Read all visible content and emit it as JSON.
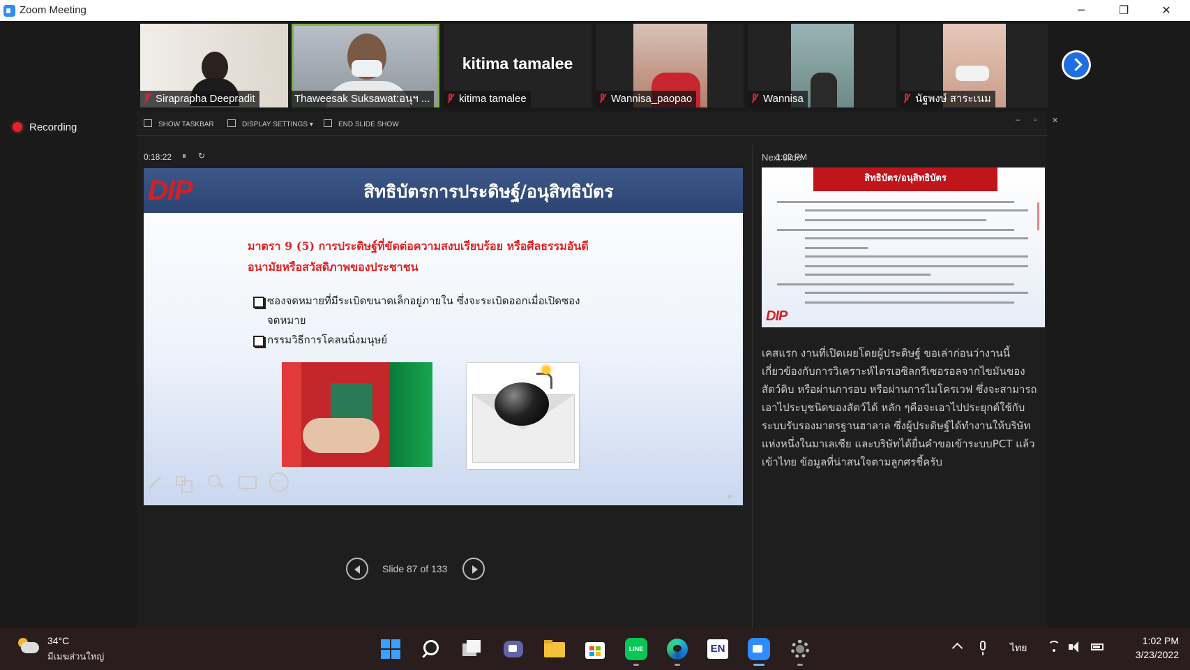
{
  "window": {
    "title": "Zoom Meeting",
    "minimize": "─",
    "maximize": "❐",
    "close": "✕"
  },
  "participants": [
    {
      "name": "Siraprapha Deepradit"
    },
    {
      "name": "Thaweesak Suksawat:อนุฯ ..."
    },
    {
      "name": "kitima tamalee",
      "display_name": "kitima tamalee"
    },
    {
      "name": "Wannisa_paopao"
    },
    {
      "name": "Wannisa"
    },
    {
      "name": "นัฐพงษ์ สาระเนม"
    }
  ],
  "recording": {
    "label": "Recording"
  },
  "presenter_toolbar": {
    "show_taskbar": "SHOW TASKBAR",
    "display_settings": "DISPLAY SETTINGS ▾",
    "end_slide_show": "END SLIDE SHOW",
    "win_minimize": "–",
    "win_restore": "▫",
    "win_close": "✕"
  },
  "timer": {
    "elapsed": "0:18:22",
    "pause": "⏸",
    "reset": "↻",
    "clock": "1:02 PM"
  },
  "current_slide": {
    "logo": "DIP",
    "title": "สิทธิบัตรการประดิษฐ์/อนุสิทธิบัตร",
    "subtitle": "มาตรา 9 (5) การประดิษฐ์ที่ขัดต่อความสงบเรียบร้อย หรือศีลธรรมอันดี อนามัยหรือสวัสดิภาพของประชาชน",
    "bullets": [
      "ซองจดหมายที่มีระเบิดขนาดเล็กอยู่ภายใน ซึ่งจะระเบิดออกเมื่อเปิดซองจดหมาย",
      "กรรมวิธีการโคลนนิ่งมนุษย์"
    ],
    "page_number": "87"
  },
  "navigation": {
    "label": "Slide 87 of 133"
  },
  "next_slide": {
    "label": "Next slide",
    "title": "สิทธิบัตร/อนุสิทธิบัตร",
    "logo": "DIP"
  },
  "notes": "เคสแรก งานที่เปิดเผยโดยผู้ประดิษฐ์ ขอเล่าก่อนว่างานนี้เกี่ยวข้องกับการวิเคราะห์ไตรเอซิลกรีเซอรอลจากไขมันของสัตว์ดิบ หรือผ่านการอบ หรือผ่านการไมโครเวฟ ซึ่งจะสามารถเอาไประบุชนิดของสัตว์ได้ หลัก ๆคือจะเอาไปประยุกต์ใช้กับระบบรับรองมาตรฐานฮาลาล ซึ่งผู้ประดิษฐ์ได้ทำงานให้บริษัทแห่งหนึ่งในมาเลเซีย และบริษัทได้ยื่นคำขอเข้าระบบPCT แล้วเข้าไทย ข้อมูลที่น่าสนใจตามลูกศรชี้ครับ",
  "taskbar": {
    "weather_temp": "34°C",
    "weather_condition": "มีเมฆส่วนใหญ่",
    "language": "ไทย",
    "time": "1:02 PM",
    "date": "3/23/2022"
  }
}
